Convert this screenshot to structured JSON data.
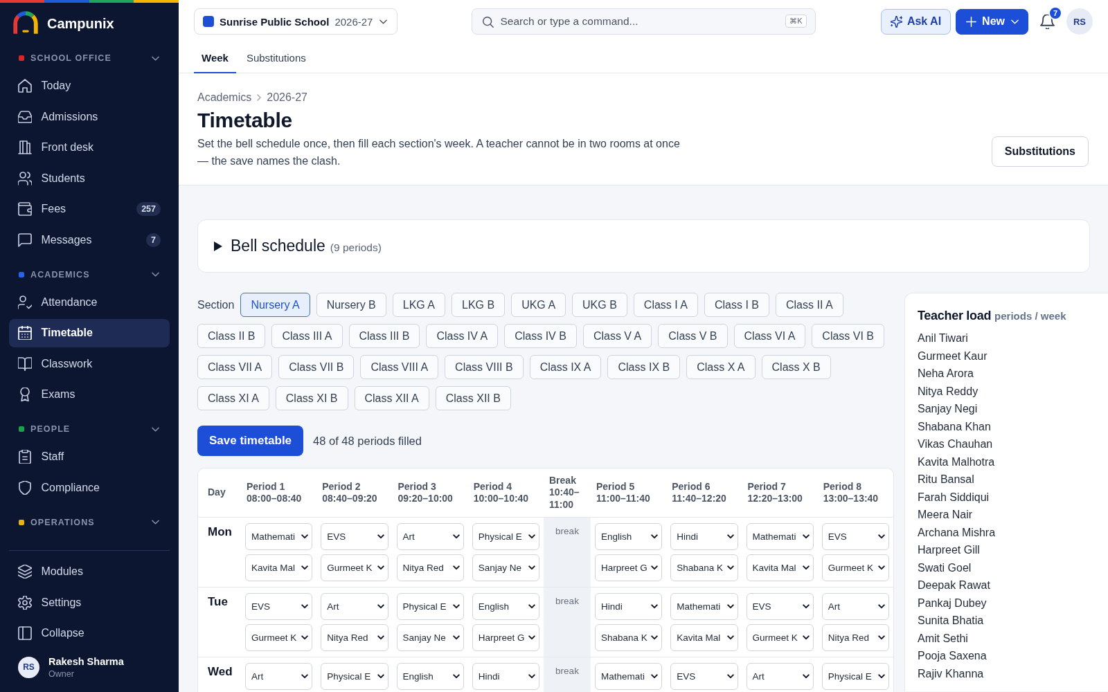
{
  "sidebar": {
    "brand": "Campunix",
    "groups": [
      {
        "title": "SCHOOL OFFICE",
        "color": "#dc2626",
        "expanded": true,
        "items": [
          {
            "label": "Today",
            "selected": false
          },
          {
            "label": "Admissions",
            "selected": false
          },
          {
            "label": "Front desk",
            "selected": false
          },
          {
            "label": "Students",
            "selected": false
          },
          {
            "label": "Fees",
            "badge": "257",
            "selected": false
          },
          {
            "label": "Messages",
            "badge": "7",
            "selected": false
          }
        ]
      },
      {
        "title": "ACADEMICS",
        "color": "#2563eb",
        "expanded": true,
        "items": [
          {
            "label": "Attendance",
            "selected": false
          },
          {
            "label": "Timetable",
            "selected": true
          },
          {
            "label": "Classwork",
            "selected": false
          },
          {
            "label": "Exams",
            "selected": false
          }
        ]
      },
      {
        "title": "PEOPLE",
        "color": "#16a34a",
        "expanded": true,
        "items": [
          {
            "label": "Staff",
            "selected": false
          },
          {
            "label": "Compliance",
            "selected": false
          }
        ]
      },
      {
        "title": "OPERATIONS",
        "color": "#eab308",
        "expanded": true
      }
    ],
    "footer_items": [
      "Modules",
      "Settings",
      "Collapse"
    ],
    "user": {
      "initials": "RS",
      "name": "Rakesh Sharma",
      "role": "Owner"
    }
  },
  "topbar": {
    "school": {
      "name": "Sunrise Public School",
      "year": "2026-27"
    },
    "search": {
      "placeholder": "Search or type a command...",
      "shortcut": "⌘K"
    },
    "ask_ai": "Ask AI",
    "new": "New",
    "notifications": "7",
    "avatar": "RS"
  },
  "tabs": [
    {
      "label": "Week",
      "selected": true
    },
    {
      "label": "Substitutions",
      "selected": false
    }
  ],
  "page_header": {
    "breadcrumb": [
      "Academics",
      "2026-27"
    ],
    "title": "Timetable",
    "description": "Set the bell schedule once, then fill each section's week. A teacher cannot be in two rooms at once — the save names the clash.",
    "action": "Substitutions"
  },
  "bell_schedule": {
    "title": "Bell schedule",
    "note": "(9 periods)",
    "expanded": false
  },
  "sections": {
    "label": "Section",
    "items": [
      {
        "label": "Nursery A",
        "selected": true
      },
      {
        "label": "Nursery B",
        "selected": false
      },
      {
        "label": "LKG A",
        "selected": false
      },
      {
        "label": "LKG B",
        "selected": false
      },
      {
        "label": "UKG A",
        "selected": false
      },
      {
        "label": "UKG B",
        "selected": false
      },
      {
        "label": "Class I A",
        "selected": false
      },
      {
        "label": "Class I B",
        "selected": false
      },
      {
        "label": "Class II A",
        "selected": false
      },
      {
        "label": "Class II B",
        "selected": false
      },
      {
        "label": "Class III A",
        "selected": false
      },
      {
        "label": "Class III B",
        "selected": false
      },
      {
        "label": "Class IV A",
        "selected": false
      },
      {
        "label": "Class IV B",
        "selected": false
      },
      {
        "label": "Class V A",
        "selected": false
      },
      {
        "label": "Class V B",
        "selected": false
      },
      {
        "label": "Class VI A",
        "selected": false
      },
      {
        "label": "Class VI B",
        "selected": false
      },
      {
        "label": "Class VII A",
        "selected": false
      },
      {
        "label": "Class VII B",
        "selected": false
      },
      {
        "label": "Class VIII A",
        "selected": false
      },
      {
        "label": "Class VIII B",
        "selected": false
      },
      {
        "label": "Class IX A",
        "selected": false
      },
      {
        "label": "Class IX B",
        "selected": false
      },
      {
        "label": "Class X A",
        "selected": false
      },
      {
        "label": "Class X B",
        "selected": false
      },
      {
        "label": "Class XI A",
        "selected": false
      },
      {
        "label": "Class XI B",
        "selected": false
      },
      {
        "label": "Class XII A",
        "selected": false
      },
      {
        "label": "Class XII B",
        "selected": false
      }
    ]
  },
  "save_bar": {
    "button": "Save timetable",
    "status": "48 of 48 periods filled"
  },
  "timetable": {
    "columns": [
      {
        "kind": "day",
        "label": "Day"
      },
      {
        "kind": "period",
        "label": "Period 1",
        "time": "08:00–08:40"
      },
      {
        "kind": "period",
        "label": "Period 2",
        "time": "08:40–09:20"
      },
      {
        "kind": "period",
        "label": "Period 3",
        "time": "09:20–10:00"
      },
      {
        "kind": "period",
        "label": "Period 4",
        "time": "10:00–10:40"
      },
      {
        "kind": "break",
        "label": "Break",
        "time": "10:40–11:00"
      },
      {
        "kind": "period",
        "label": "Period 5",
        "time": "11:00–11:40"
      },
      {
        "kind": "period",
        "label": "Period 6",
        "time": "11:40–12:20"
      },
      {
        "kind": "period",
        "label": "Period 7",
        "time": "12:20–13:00"
      },
      {
        "kind": "period",
        "label": "Period 8",
        "time": "13:00–13:40"
      }
    ],
    "rows": [
      {
        "cells": [
          {
            "kind": "day",
            "label": "Mon"
          },
          {
            "kind": "lesson",
            "subject": "Mathemati",
            "teacher": "Kavita Mal"
          },
          {
            "kind": "lesson",
            "subject": "EVS",
            "teacher": "Gurmeet K"
          },
          {
            "kind": "lesson",
            "subject": "Art",
            "teacher": "Nitya Red"
          },
          {
            "kind": "lesson",
            "subject": "Physical E",
            "teacher": "Sanjay Ne"
          },
          {
            "kind": "break",
            "label": "break"
          },
          {
            "kind": "lesson",
            "subject": "English",
            "teacher": "Harpreet G"
          },
          {
            "kind": "lesson",
            "subject": "Hindi",
            "teacher": "Shabana K"
          },
          {
            "kind": "lesson",
            "subject": "Mathemati",
            "teacher": "Kavita Mal"
          },
          {
            "kind": "lesson",
            "subject": "EVS",
            "teacher": "Gurmeet K"
          }
        ]
      },
      {
        "cells": [
          {
            "kind": "day",
            "label": "Tue"
          },
          {
            "kind": "lesson",
            "subject": "EVS",
            "teacher": "Gurmeet K"
          },
          {
            "kind": "lesson",
            "subject": "Art",
            "teacher": "Nitya Red"
          },
          {
            "kind": "lesson",
            "subject": "Physical E",
            "teacher": "Sanjay Ne"
          },
          {
            "kind": "lesson",
            "subject": "English",
            "teacher": "Harpreet G"
          },
          {
            "kind": "break",
            "label": "break"
          },
          {
            "kind": "lesson",
            "subject": "Hindi",
            "teacher": "Shabana K"
          },
          {
            "kind": "lesson",
            "subject": "Mathemati",
            "teacher": "Kavita Mal"
          },
          {
            "kind": "lesson",
            "subject": "EVS",
            "teacher": "Gurmeet K"
          },
          {
            "kind": "lesson",
            "subject": "Art",
            "teacher": "Nitya Red"
          }
        ]
      },
      {
        "cells": [
          {
            "kind": "day",
            "label": "Wed"
          },
          {
            "kind": "lesson",
            "subject": "Art"
          },
          {
            "kind": "lesson",
            "subject": "Physical E"
          },
          {
            "kind": "lesson",
            "subject": "English"
          },
          {
            "kind": "lesson",
            "subject": "Hindi"
          },
          {
            "kind": "break",
            "label": "break"
          },
          {
            "kind": "lesson",
            "subject": "Mathemati"
          },
          {
            "kind": "lesson",
            "subject": "EVS"
          },
          {
            "kind": "lesson",
            "subject": "Art"
          },
          {
            "kind": "lesson",
            "subject": "Physical E"
          }
        ]
      }
    ]
  },
  "teacher_load": {
    "title": "Teacher load",
    "unit": "periods / week",
    "teachers": [
      "Anil Tiwari",
      "Gurmeet Kaur",
      "Neha Arora",
      "Nitya Reddy",
      "Sanjay Negi",
      "Shabana Khan",
      "Vikas Chauhan",
      "Kavita Malhotra",
      "Ritu Bansal",
      "Farah Siddiqui",
      "Meera Nair",
      "Archana Mishra",
      "Harpreet Gill",
      "Swati Goel",
      "Deepak Rawat",
      "Pankaj Dubey",
      "Sunita Bhatia",
      "Amit Sethi",
      "Pooja Saxena",
      "Rajiv Khanna"
    ]
  }
}
